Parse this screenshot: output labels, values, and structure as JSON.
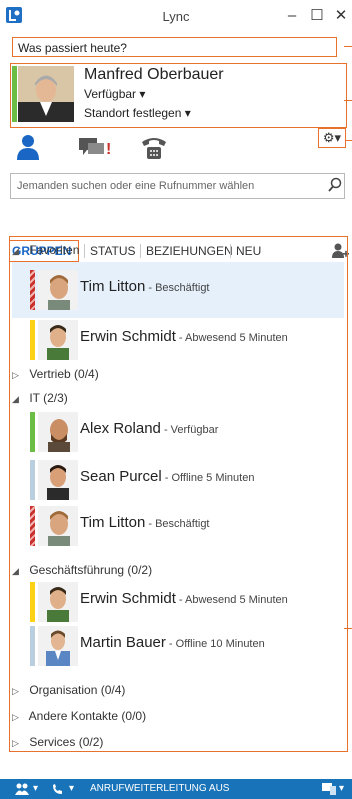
{
  "window": {
    "title": "Lync",
    "minimize_label": "–",
    "maximize_label": "☐",
    "close_label": "✕"
  },
  "note": {
    "placeholder": "Was passiert heute?"
  },
  "profile": {
    "name": "Manfred Oberbauer",
    "availability": "Verfügbar ▾",
    "location": "Standort festlegen ▾",
    "presence_color": "#6bbd45"
  },
  "toolbar": {
    "icons": [
      "contacts-icon",
      "conversations-icon",
      "phone-icon"
    ],
    "options_label": "⚙▾"
  },
  "search": {
    "placeholder": "Jemanden suchen oder eine Rufnummer wählen"
  },
  "tabs": [
    "GRUPPEN",
    "STATUS",
    "BEZIEHUNGEN",
    "NEU"
  ],
  "groups": {
    "favoriten": "Favoriten",
    "vertrieb": "Vertrieb (0/4)",
    "it": "IT (2/3)",
    "gf": "Geschäftsführung (0/2)",
    "org": "Organisation (0/4)",
    "andere": "Andere Kontakte (0/0)",
    "services": "Services (0/2)"
  },
  "contacts": {
    "fav1": {
      "name": "Tim Litton",
      "status": " - Beschäftigt"
    },
    "fav2": {
      "name": "Erwin Schmidt",
      "status": " - Abwesend 5 Minuten"
    },
    "it1": {
      "name": "Alex Roland",
      "status": " - Verfügbar"
    },
    "it2": {
      "name": "Sean Purcel",
      "status": " - Offline 5 Minuten"
    },
    "it3": {
      "name": "Tim Litton",
      "status": " - Beschäftigt"
    },
    "gf1": {
      "name": "Erwin Schmidt",
      "status": " - Abwesend 5 Minuten"
    },
    "gf2": {
      "name": "Martin Bauer",
      "status": " - Offline 10 Minuten"
    }
  },
  "bottombar": {
    "forwarding": "ANRUFWEITERLEITUNG AUS"
  },
  "colors": {
    "accent": "#1a66c4",
    "annotation": "#e8722c",
    "available": "#6bbd45",
    "away": "#fcd116",
    "busy": "#c8312c",
    "offline": "#b9cfe0"
  }
}
